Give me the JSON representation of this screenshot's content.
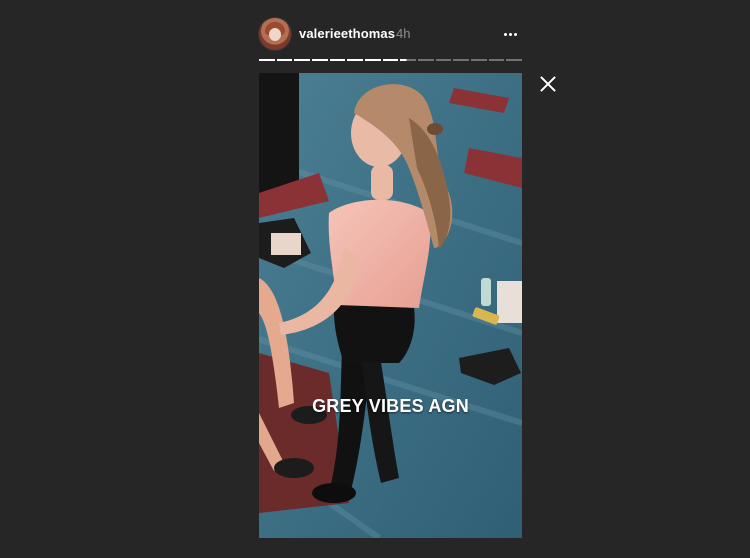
{
  "story": {
    "username": "valerieethomas",
    "timestamp": "4h",
    "caption": "GREY VIBES AGN",
    "progress": {
      "total_segments": 15,
      "completed": 8,
      "current_fraction": 0.4
    }
  },
  "icons": {
    "more": "more-horizontal-icon",
    "close": "close-icon"
  },
  "colors": {
    "background": "#262626",
    "text_primary": "#ffffff",
    "text_secondary": "#8e8e8e",
    "carpet": "#3d6f86",
    "mat": "#7a2f2f",
    "shirt": "#f2b3a8"
  }
}
